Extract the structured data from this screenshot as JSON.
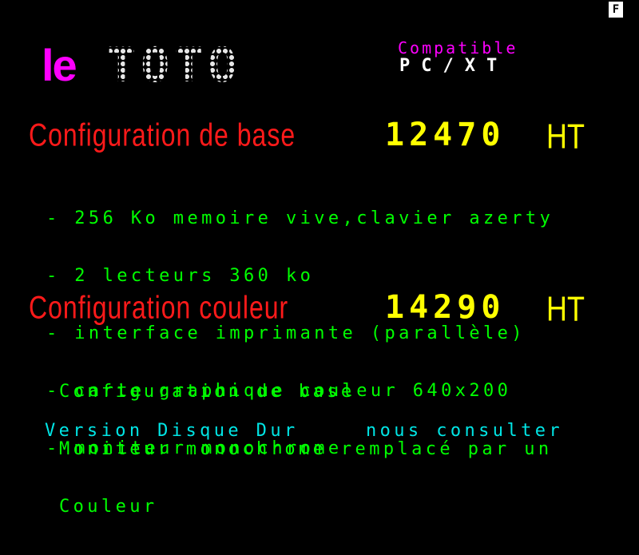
{
  "screen": {
    "corner_indicator": "F",
    "logo": {
      "prefix": "le",
      "name": "TOTO"
    },
    "compat": {
      "line1": "Compatible",
      "line2": "PC/XT"
    },
    "config_base": {
      "title": "Configuration de base",
      "price": "12470",
      "unit": "HT",
      "features": [
        "- 256 Ko memoire vive,clavier azerty",
        "- 2 lecteurs 360 ko",
        "- interface imprimante (parallèle)",
        "- carte graphique couleur 640x200",
        "- moniteur monochrome"
      ]
    },
    "config_couleur": {
      "title": "Configuration couleur",
      "price": "14290",
      "unit": "HT",
      "details": [
        "Configuration de base",
        "Moniteur monochrome remplacé par un",
        "Couleur"
      ]
    },
    "footer": {
      "left": "Version Disque Dur",
      "right": "nous consulter"
    },
    "colors": {
      "background": "#000000",
      "red": "#ff1a1a",
      "yellow": "#ffff00",
      "green": "#00ff00",
      "cyan": "#00e5e5",
      "magenta": "#ff00ff",
      "white": "#ffffff"
    }
  }
}
